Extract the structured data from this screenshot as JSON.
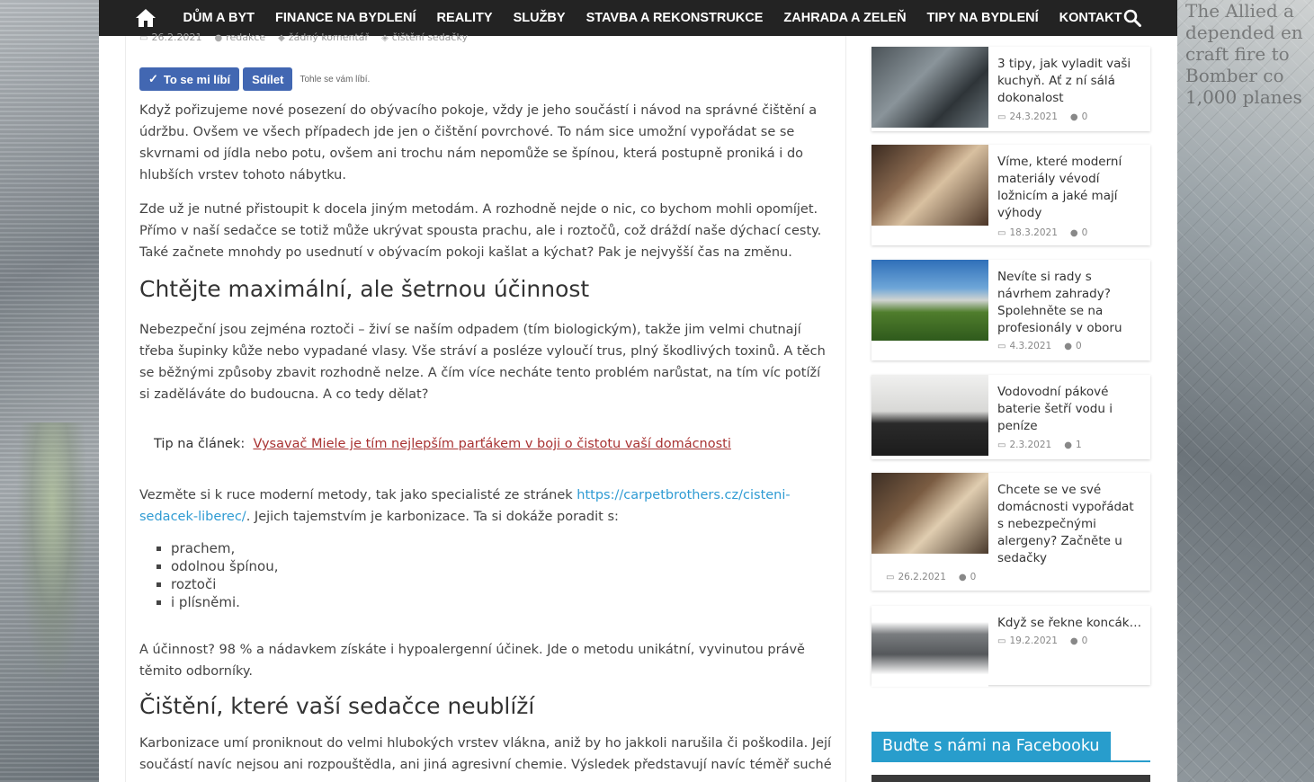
{
  "nav": {
    "items": [
      "DŮM A BYT",
      "FINANCE NA BYDLENÍ",
      "REALITY",
      "SLUŽBY",
      "STAVBA A REKONSTRUKCE",
      "ZAHRADA A ZELEŇ",
      "TIPY NA BYDLENÍ",
      "KONTAKT"
    ]
  },
  "meta": {
    "date": "26.2.2021",
    "author": "redakce",
    "comments": "žádný komentář",
    "tag": "čištění sedačky"
  },
  "fb": {
    "like": "To se mi líbí",
    "share": "Sdílet",
    "note": "Tohle se vám líbí."
  },
  "article": {
    "p1": "Když pořizujeme nové posezení do obývacího pokoje, vždy je jeho součástí i návod na správné čištění a údržbu. Ovšem ve všech případech jde jen o čištění povrchové. To nám sice umožní vypořádat se se skvrnami od jídla nebo potu, ovšem ani trochu nám nepomůže se špínou, která postupně proniká i do hlubších vrstev tohoto nábytku.",
    "p2": "Zde už je nutné přistoupit k docela jiným metodám. A rozhodně nejde o nic, co bychom mohli opomíjet. Přímo v naší sedačce se totiž může ukrývat spousta prachu, ale i roztočů, což dráždí naše dýchací cesty. Také začnete mnohdy po usednutí v obývacím pokoji kašlat a kýchat? Pak je nejvyšší čas na změnu.",
    "h1": "Chtějte maximální, ale šetrnou účinnost",
    "p3": "Nebezpeční jsou zejména roztoči – živí se naším odpadem (tím biologickým), takže jim velmi chutnají třeba šupinky kůže nebo vypadané vlasy. Vše stráví a posléze vyloučí trus, plný škodlivých toxinů. A těch se běžnými způsoby zbavit rozhodně nelze.  A čím více necháte tento problém narůstat, na tím víc potíží si zaděláváte do budoucna.  A co tedy dělat?",
    "tip_label": "Tip na článek:",
    "tip_link": "Vysavač Miele je tím nejlepším parťákem v boji o čistotu vaší domácnosti",
    "p4_pre": "Vezměte si k ruce moderní metody, tak jako specialisté ze stránek ",
    "p4_link": "https://carpetbrothers.cz/cisteni-sedacek-liberec/",
    "p4_post": ". Jejich tajemstvím je karbonizace. Ta si dokáže poradit s:",
    "list": [
      "prachem,",
      "odolnou špínou,",
      "roztoči",
      "i plísněmi."
    ],
    "p5": "A účinnost? 98 % a nádavkem získáte i hypoalergenní účinek. Jde o metodu unikátní, vyvinutou právě těmito odborníky.",
    "h2": "Čištění, které vaší sedačce neublíží",
    "p6": "Karbonizace umí proniknout do velmi hlubokých vrstev vlákna, aniž by ho jakkoli narušila či poškodila. Její součástí navíc nejsou ani rozpouštědla, ani jiná agresivní chemie. Výsledek představují navíc téměř suché"
  },
  "sidebar": {
    "posts": [
      {
        "title": "3 tipy, jak vyladit vaši kuchyň. Ať z ní sálá dokonalost",
        "date": "24.3.2021",
        "comments": "0"
      },
      {
        "title": "Víme, které moderní materiály vévodí ložnicím a jaké mají výhody",
        "date": "18.3.2021",
        "comments": "0"
      },
      {
        "title": "Nevíte si rady s návrhem zahrady? Spolehněte se na profesionály v oboru",
        "date": "4.3.2021",
        "comments": "0"
      },
      {
        "title": "Vodovodní pákové baterie šetří vodu i peníze",
        "date": "2.3.2021",
        "comments": "1"
      },
      {
        "title": "Chcete se ve své domácnosti vypořádat s nebezpečnými alergeny? Začněte u sedačky",
        "date": "26.2.2021",
        "comments": "0"
      },
      {
        "title": "Když se řekne koncák…",
        "date": "19.2.2021",
        "comments": "0"
      }
    ],
    "facebook_title": "Buďte s námi na Facebooku"
  },
  "background_text": "The Allied a\ndepended en\ncraft fire to\nBomber co\n1,000 planes"
}
